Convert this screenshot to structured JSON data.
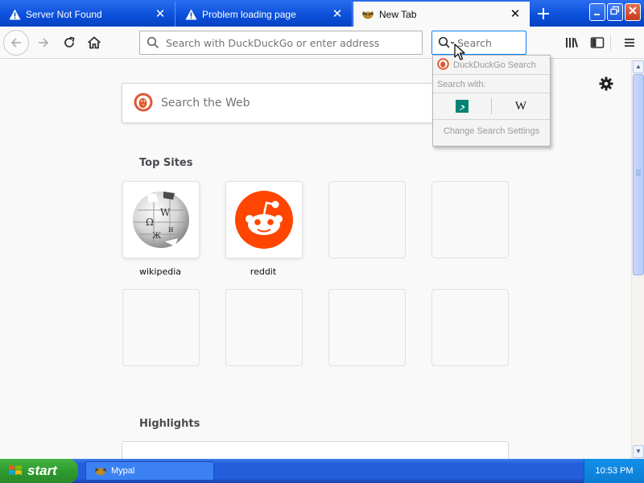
{
  "tabs": [
    {
      "title": "Server Not Found",
      "icon": "warning-icon",
      "active": false
    },
    {
      "title": "Problem loading page",
      "icon": "warning-icon",
      "active": false
    },
    {
      "title": "New Tab",
      "icon": "mypal-icon",
      "active": true
    }
  ],
  "toolbar": {
    "url_placeholder": "Search with DuckDuckGo or enter address",
    "search_placeholder": "Search"
  },
  "search_popup": {
    "engine_header": "DuckDuckGo Search",
    "search_with": "Search with:",
    "engines": [
      "bing-icon",
      "wikipedia-icon"
    ],
    "wiki_glyph": "W",
    "change_settings": "Change Search Settings"
  },
  "page": {
    "web_search_placeholder": "Search the Web",
    "top_sites_title": "Top Sites",
    "highlights_title": "Highlights",
    "top_sites": [
      {
        "label": "wikipedia",
        "icon": "wikipedia-logo"
      },
      {
        "label": "reddit",
        "icon": "reddit-logo"
      }
    ]
  },
  "taskbar": {
    "start_label": "start",
    "task_label": "Mypal",
    "clock": "10:53 PM"
  },
  "colors": {
    "titlebar": "#0a4fd9",
    "accent": "#0a84ff",
    "ddg_orange": "#de5833",
    "reddit_orange": "#ff4500",
    "bing_teal": "#008373",
    "start_green": "#2e9b2e"
  }
}
